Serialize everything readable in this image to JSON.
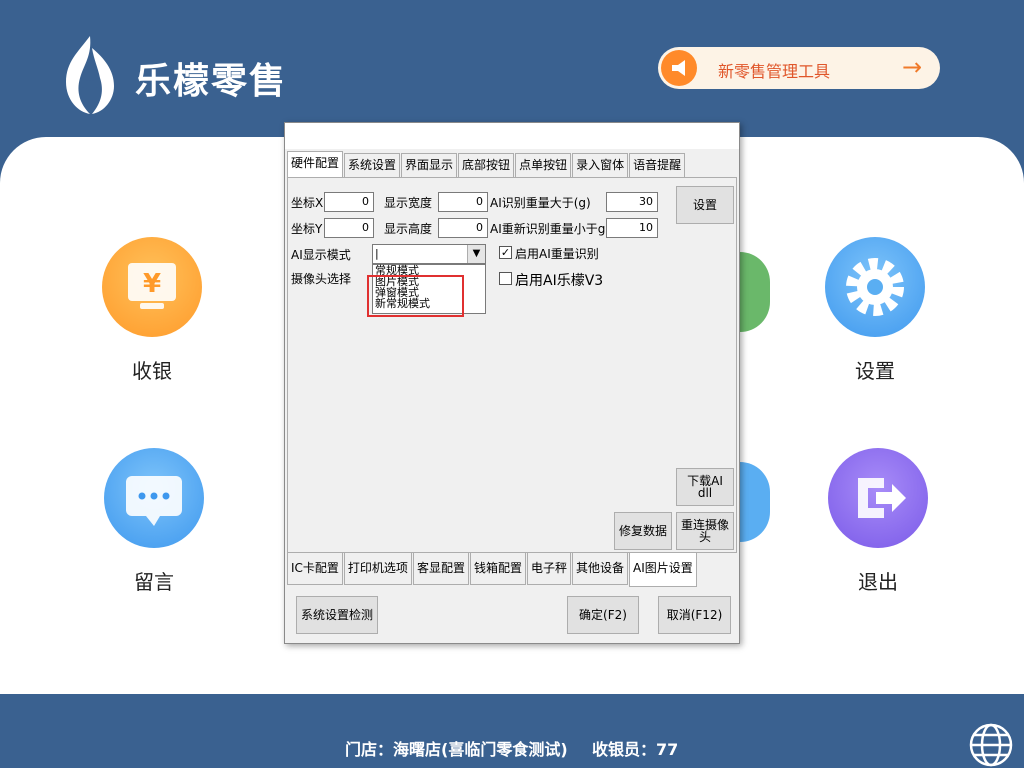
{
  "brand": {
    "name": "乐檬零售"
  },
  "tool": {
    "label": "新零售管理工具",
    "arrow": "→"
  },
  "tiles": [
    {
      "label": "收银",
      "icon": "cashier-icon",
      "color": "#ffa33a"
    },
    {
      "label": "设置",
      "icon": "gear-icon",
      "color": "#4da8f0"
    },
    {
      "label": "留言",
      "icon": "message-icon",
      "color": "#4da8f0"
    },
    {
      "label": "退出",
      "icon": "exit-icon",
      "color": "#8a6af0"
    }
  ],
  "footer": {
    "store": "门店：海曙店(喜临门零食测试)",
    "cashier": "收银员：77"
  },
  "dialog": {
    "tabs_top": [
      "硬件配置",
      "系统设置",
      "界面显示",
      "底部按钮",
      "点单按钮",
      "录入窗体",
      "语音提醒"
    ],
    "tabs_bottom": [
      "IC卡配置",
      "打印机选项",
      "客显配置",
      "钱箱配置",
      "电子秤",
      "其他设备",
      "AI图片设置"
    ],
    "fields": {
      "x_label": "坐标X",
      "x_value": "0",
      "y_label": "坐标Y",
      "y_value": "0",
      "width_label": "显示宽度",
      "width_value": "0",
      "height_label": "显示高度",
      "height_value": "0",
      "ai_weight_label": "AI识别重量大于(g)",
      "ai_weight_value": "30",
      "ai_reweight_label": "AI重新识别重量小于g",
      "ai_reweight_value": "10",
      "ai_mode_label": "AI显示模式",
      "camera_label": "摄像头选择"
    },
    "combo": {
      "value": "|",
      "arrow": "▼"
    },
    "dropdown_options": [
      "常规模式",
      "图片模式",
      "弹窗模式",
      "新常规模式"
    ],
    "checks": {
      "enable_weight": {
        "label": "启用AI重量识别",
        "checked": true,
        "mark": "✓"
      },
      "enable_v3": {
        "label": "启用AI乐檬V3",
        "checked": false
      }
    },
    "buttons": {
      "setting": "设置",
      "download_line1": "下载AI",
      "download_line2": "dll",
      "repair": "修复数据",
      "reconnect_line1": "重连摄像",
      "reconnect_line2": "头",
      "check": "系统设置检测",
      "ok": "确定(F2)",
      "cancel": "取消(F12)"
    }
  }
}
